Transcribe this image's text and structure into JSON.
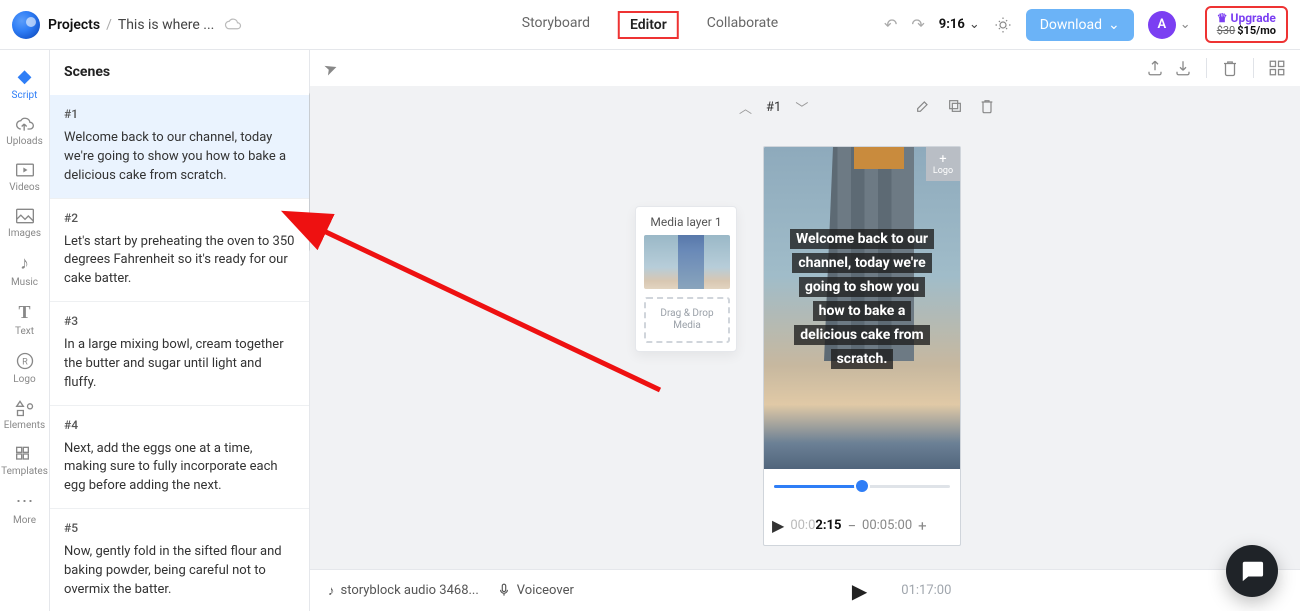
{
  "topbar": {
    "breadcrumb_root": "Projects",
    "breadcrumb_title": "This is where ...",
    "nav_storyboard": "Storyboard",
    "nav_editor": "Editor",
    "nav_collab": "Collaborate",
    "aspect": "9:16",
    "download": "Download",
    "avatar_letter": "A",
    "upgrade_label": "Upgrade",
    "upgrade_old_price": "$30",
    "upgrade_new_price": "$15/mo"
  },
  "leftcol": {
    "script": "Script",
    "uploads": "Uploads",
    "videos": "Videos",
    "images": "Images",
    "music": "Music",
    "text": "Text",
    "logo": "Logo",
    "elements": "Elements",
    "templates": "Templates",
    "more": "More"
  },
  "scenes": {
    "panel_title": "Scenes",
    "items": [
      {
        "num": "#1",
        "text": "Welcome back to our channel, today we're going to show you how to bake a delicious cake from scratch."
      },
      {
        "num": "#2",
        "text": "Let's start by preheating the oven to 350 degrees Fahrenheit so it's ready for our cake batter."
      },
      {
        "num": "#3",
        "text": "In a large mixing bowl, cream together the butter and sugar until light and fluffy."
      },
      {
        "num": "#4",
        "text": "Next, add the eggs one at a time, making sure to fully incorporate each egg before adding the next."
      },
      {
        "num": "#5",
        "text": "Now, gently fold in the sifted flour and baking powder, being careful not to overmix the batter."
      }
    ]
  },
  "media_popup": {
    "title": "Media layer 1",
    "drop_label": "Drag & Drop Media"
  },
  "preview": {
    "scene_num": "#1",
    "logo_chip": "Logo",
    "caption_lines": [
      "Welcome back to our",
      "channel, today we're",
      "going to show you",
      "how to bake a",
      "delicious cake from",
      "scratch."
    ],
    "time_current_prefix": "00:0",
    "time_current_bold": "2:15",
    "time_total": "00:05:00"
  },
  "bottombar": {
    "audio_label": "storyblock audio 3468...",
    "voiceover_label": "Voiceover",
    "total_time": "01:17:00"
  }
}
